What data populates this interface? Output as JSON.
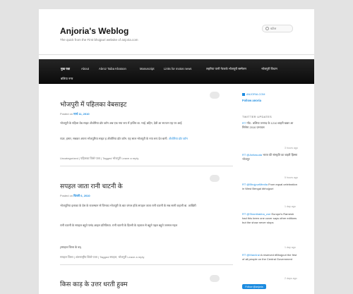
{
  "header": {
    "site_title": "Anjoria's Weblog",
    "site_description": "The quick from the First bhojpuri website of anjoria.com",
    "search_placeholder": "खोज"
  },
  "nav": {
    "items": [
      "मुख पन्ना",
      "About",
      "Abroz Taiba Khatoon",
      "Manuscript",
      "Links for motos news",
      "लहरिया पानी नेटवर्क भोजपुरी सम्मेलन",
      "भोजपुरी विधान",
      "बलिया नगर"
    ]
  },
  "posts": [
    {
      "title": "भोजपुरी में पहिलका वेबसाइट",
      "posted_label": "Posted on",
      "posted_date": "मार्च 11, 2010",
      "paragraph": "भोजपुरी के पहिला वेब साइट अँजोरिया डॉट कॉम अब एक नया रूप में हाजिर बा. भाई, बहिन, देवी आ सज्जन एह पर आईं.",
      "paragraph2": "राउर, हमार, सबकर अपना भोजपुरिया साइट ह अँजोरिया डॉट कॉम. एह साल भोजपुरी के नया रूप देत बानी.",
      "link_text": "अँजोरिया डॉट कॉम",
      "tags": "Uncategorized | पहिलका किंसे पाता | Tagged भोजपुरी Leave a reply"
    },
    {
      "title": "सपहल जाता रानी चाटनी के",
      "posted_label": "Posted on",
      "posted_date": "फिवरी 6, 2010",
      "paragraph": "भोजपुरिया इलाका के देस के राजस्थान से जिनका भोजपुरी के बाट जंगल होके सपहल जाता रानी चाटनी के सब सानी कहानी बा. आखिरी",
      "paragraph2": "रानी चाटनी के सपहल बहुते पसंद आइल प्रतिविध्या. रानी चाटनी के दिल्ली के रहताल से बहुते पढ़ल बहुते जनमल गइल",
      "read_more": "(सपहल जिला के बा)",
      "tags": "सपहल जिला | अंतरराष्ट्रीय किंसे पाता | Tagged सपहल, भोजपुरी Leave a reply"
    },
    {
      "title": "किस काड़ के उत्तर धरती हुक्म"
    }
  ],
  "sidebar": {
    "widget_header": "ANJORIA.COM",
    "follow_link": "Follow anoria",
    "twitter_title": "TWITTER UPDATES",
    "tweets": [
      {
        "handle": "RT",
        "text": "गाँव : बलिया जनपद के 1210 बाहरी खबर आ सिनेमा 2010 प्रभावल",
        "time": "3 hours ago"
      },
      {
        "handle": "RT @Anitasuda",
        "text": "भारत की संस्कृति का बाहरी हिस्सा भोजपुर",
        "time": "5 hours ago"
      },
      {
        "handle": "RT @BhojpuriMedia",
        "text": "From equal celebration in West Bengal #bhojpuri",
        "time": "1 day ago"
      },
      {
        "handle": "RT @Shantirakha_zoe",
        "text": "Europe's Ramesh had this been one cover says other editions but the show never stops",
        "time": "1 day ago"
      },
      {
        "handle": "RT @Man4rai",
        "text": "A reserved #Bhojpuri the first of all people on the Central Government",
        "time": "2 days ago"
      }
    ],
    "follow_badge": "Follow @anjoria"
  }
}
